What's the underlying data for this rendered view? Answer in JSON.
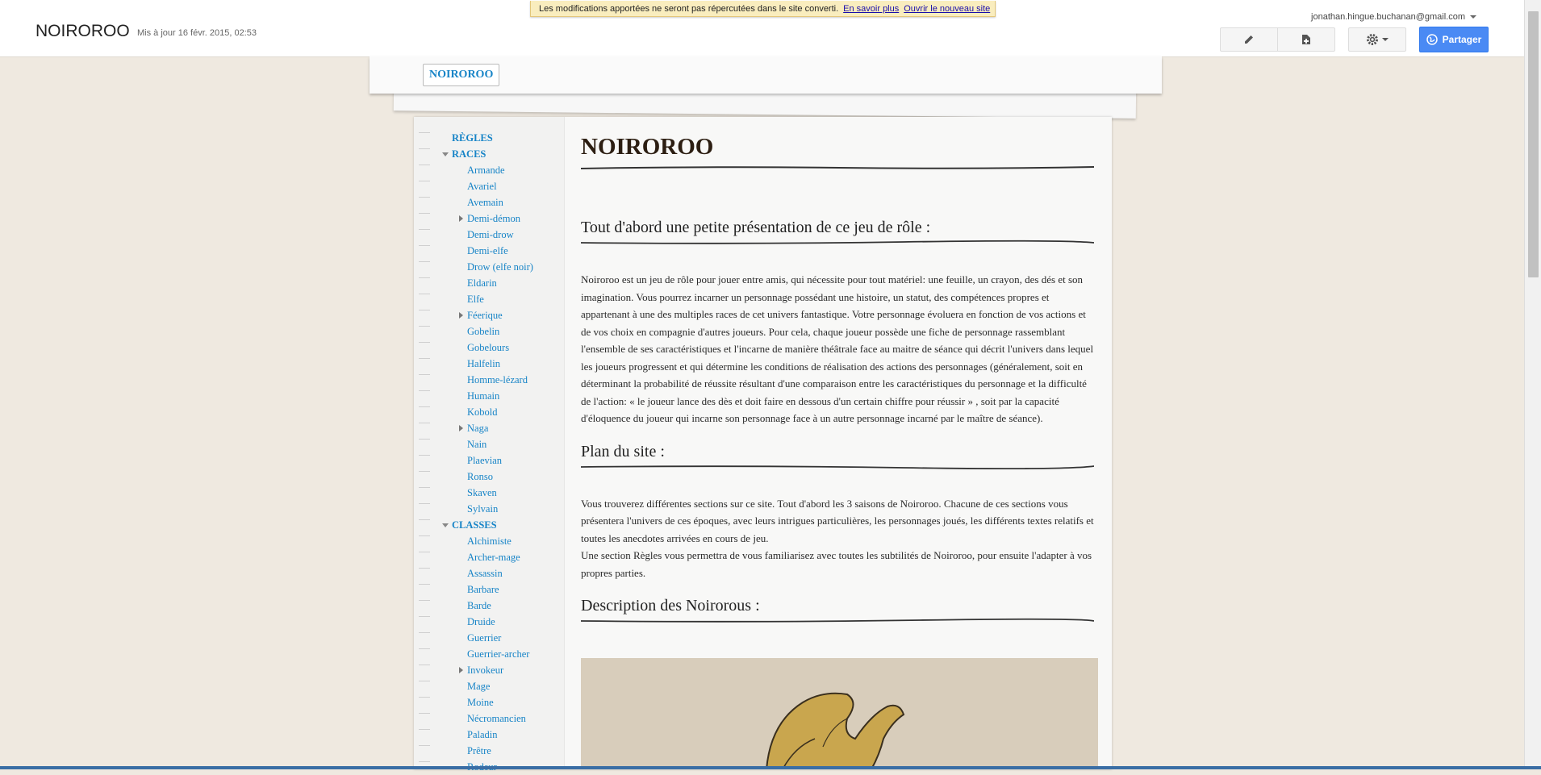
{
  "topbar": {
    "site_title": "NOIROROO",
    "updated": "Mis à jour 16 févr. 2015, 02:53",
    "notice_text": "Les modifications apportées ne seront pas répercutées dans le site converti.",
    "notice_link1": "En savoir plus",
    "notice_link2": "Ouvrir le nouveau site",
    "user_email": "jonathan.hingue.buchanan@gmail.com",
    "share_label": "Partager"
  },
  "header_tab": "NOIROROO",
  "nav": {
    "regles": "RÈGLES",
    "races": "RACES",
    "race_items": [
      "Armande",
      "Avariel",
      "Avemain",
      "Demi-démon",
      "Demi-drow",
      "Demi-elfe",
      "Drow (elfe noir)",
      "Eldarin",
      "Elfe",
      "Féerique",
      "Gobelin",
      "Gobelours",
      "Halfelin",
      "Homme-lézard",
      "Humain",
      "Kobold",
      "Naga",
      "Nain",
      "Plaevian",
      "Ronso",
      "Skaven",
      "Sylvain"
    ],
    "classes": "CLASSES",
    "class_items": [
      "Alchimiste",
      "Archer-mage",
      "Assassin",
      "Barbare",
      "Barde",
      "Druide",
      "Guerrier",
      "Guerrier-archer",
      "Invokeur",
      "Mage",
      "Moine",
      "Nécromancien",
      "Paladin",
      "Prêtre",
      "Rodeur"
    ]
  },
  "content": {
    "title": "NOIROROO",
    "section1_title": "Tout d'abord une petite présentation de ce jeu de rôle :",
    "section1_text": "Noiroroo est un jeu de rôle pour jouer entre amis, qui nécessite pour tout matériel: une feuille, un crayon, des dés et son imagination. Vous pourrez incarner un personnage possédant une histoire, un statut, des compétences propres et appartenant à une des multiples races de cet univers fantastique. Votre personnage évoluera en fonction de vos actions et de vos choix en compagnie d'autres joueurs. Pour cela, chaque joueur possède une fiche de personnage rassemblant l'ensemble de ses caractéristiques et l'incarne de manière théâtrale face au maitre de séance qui décrit l'univers dans lequel les joueurs progressent et qui détermine les conditions de réalisation des actions des personnages (généralement, soit en déterminant la probabilité de réussite résultant d'une comparaison entre les caractéristiques du personnage et la difficulté de l'action: « le joueur lance des dès et doit faire en dessous d'un certain chiffre pour réussir » , soit par la capacité d'éloquence du joueur qui incarne son personnage face à un autre personnage incarné par le maître de séance).",
    "section2_title": "Plan du site :",
    "section2_text1": "Vous trouverez différentes sections sur ce site. Tout d'abord les 3 saisons de Noiroroo. Chacune de ces sections vous présentera l'univers de ces époques, avec leurs intrigues particulières, les personnages joués, les différents textes relatifs et toutes les anecdotes arrivées en cours de jeu.",
    "section2_text2": "Une section Règles vous permettra de vous familiarisez avec toutes les subtilités de Noiroroo, pour ensuite l'adapter à vos propres parties.",
    "section3_title": "Description des Noirorous :"
  }
}
